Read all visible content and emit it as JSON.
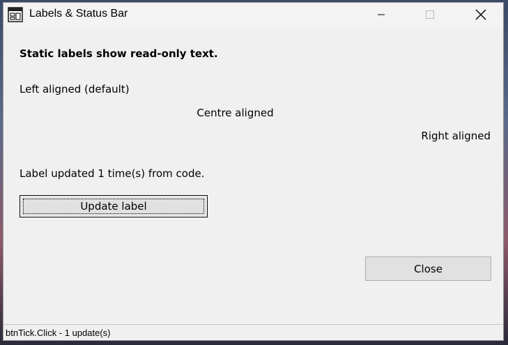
{
  "window": {
    "title": "Labels & Status Bar",
    "controls": {
      "minimize_icon": "minimize-icon",
      "maximize_icon": "maximize-icon",
      "close_icon": "close-icon"
    }
  },
  "content": {
    "heading": "Static labels show read-only text.",
    "left_label": "Left aligned (default)",
    "centre_label": "Centre aligned",
    "right_label": "Right aligned",
    "update_status": "Label updated 1 time(s) from code.",
    "update_button_label": "Update label",
    "close_button_label": "Close"
  },
  "statusbar": {
    "text": "btnTick.Click - 1 update(s)"
  },
  "colors": {
    "window_bg": "#f0f0f0",
    "button_bg": "#e1e1e1",
    "button_border": "#adadad"
  }
}
